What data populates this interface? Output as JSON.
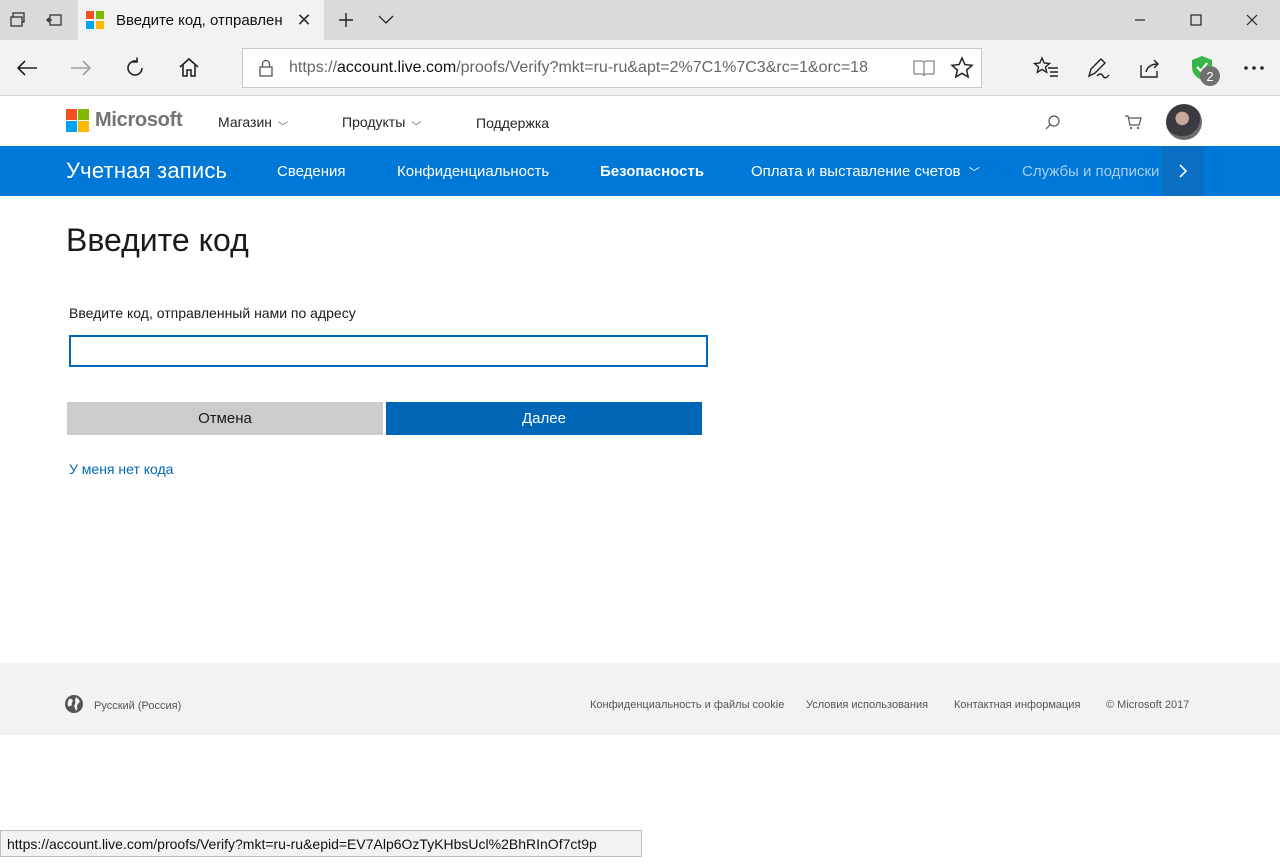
{
  "browser": {
    "tab_title": "Введите код, отправлен",
    "address_url_prefix": "https://",
    "address_url_host": "account.live.com",
    "address_url_rest": "/proofs/Verify?mkt=ru-ru&apt=2%7C1%7C3&rc=1&orc=18",
    "extension_badge": "2",
    "status_url": "https://account.live.com/proofs/Verify?mkt=ru-ru&epid=EV7Alp6OzTyKHbsUcl%2BhRInOf7ct9p",
    "favicon_colors": [
      "#f25022",
      "#7fba00",
      "#00a4ef",
      "#ffb900"
    ]
  },
  "ms_header": {
    "logo_text": "Microsoft",
    "nav": [
      "Магазин",
      "Продукты",
      "Поддержка"
    ]
  },
  "account_bar": {
    "title": "Учетная запись",
    "links": [
      "Сведения",
      "Конфиденциальность",
      "Безопасность",
      "Оплата и выставление счетов",
      "Службы и подписки"
    ],
    "active": "Безопасность",
    "accent_color": "#0078d7"
  },
  "main": {
    "title": "Введите код",
    "field_label": "Введите код, отправленный нами по адресу",
    "code_value": "",
    "cancel_label": "Отмена",
    "next_label": "Далее",
    "no_code_link": "У меня нет кода"
  },
  "footer": {
    "locale": "Русский (Россия)",
    "links": [
      "Конфиденциальность и файлы cookie",
      "Условия использования",
      "Контактная информация",
      "© Microsoft 2017"
    ]
  }
}
